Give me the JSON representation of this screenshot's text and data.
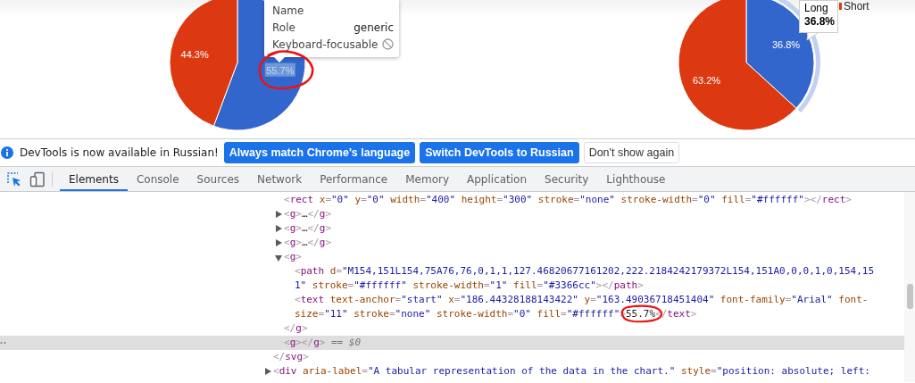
{
  "page": {
    "left_chart": {
      "chart_data": {
        "type": "pie",
        "values": [
          55.7,
          44.3
        ],
        "colors": [
          "#3366cc",
          "#dc3912"
        ]
      },
      "slices": [
        {
          "label": "55.7%",
          "label_selected": true
        },
        {
          "label": "44.3%",
          "label_selected": false
        }
      ]
    },
    "right_chart": {
      "chart_data": {
        "type": "pie",
        "values": [
          36.8,
          63.2
        ],
        "colors": [
          "#3366cc",
          "#dc3912"
        ]
      },
      "slices": [
        {
          "label": "36.8%",
          "hovered": true
        },
        {
          "label": "63.2%",
          "hovered": false
        }
      ],
      "tooltip": {
        "category": "Long",
        "value": "36.8%"
      },
      "legend": [
        {
          "label": "Short",
          "color": "#dc3912"
        }
      ]
    },
    "inspect_tooltip": {
      "rows": [
        {
          "label": "Name"
        },
        {
          "label": "Role",
          "value": "generic"
        },
        {
          "label": "Keyboard-focusable",
          "focusable": false
        }
      ]
    }
  },
  "info_bar": {
    "message": "DevTools is now available in Russian!",
    "buttons": [
      {
        "label": "Always match Chrome's language",
        "kind": "primary"
      },
      {
        "label": "Switch DevTools to Russian",
        "kind": "primary"
      },
      {
        "label": "Don't show again",
        "kind": "secondary"
      }
    ]
  },
  "tabs": [
    {
      "label": "Elements",
      "selected": true
    },
    {
      "label": "Console",
      "selected": false
    },
    {
      "label": "Sources",
      "selected": false
    },
    {
      "label": "Network",
      "selected": false
    },
    {
      "label": "Performance",
      "selected": false
    },
    {
      "label": "Memory",
      "selected": false
    },
    {
      "label": "Application",
      "selected": false
    },
    {
      "label": "Security",
      "selected": false
    },
    {
      "label": "Lighthouse",
      "selected": false
    }
  ],
  "dom_tree": [
    {
      "selected": false,
      "closing": [
        {
          "kind": "p",
          "text": "</"
        },
        {
          "kind": "tag",
          "text": "svg"
        },
        {
          "kind": "p",
          "text": ">"
        }
      ],
      "children": [
        {
          "selected": false,
          "lines": [
            [
              {
                "kind": "p",
                "text": "<"
              },
              {
                "kind": "tag",
                "text": "rect"
              },
              {
                "kind": "attr",
                "text": " x"
              },
              {
                "kind": "p",
                "text": "="
              },
              {
                "kind": "val",
                "text": "\"0\""
              },
              {
                "kind": "attr",
                "text": " y"
              },
              {
                "kind": "p",
                "text": "="
              },
              {
                "kind": "val",
                "text": "\"0\""
              },
              {
                "kind": "attr",
                "text": " width"
              },
              {
                "kind": "p",
                "text": "="
              },
              {
                "kind": "val",
                "text": "\"400\""
              },
              {
                "kind": "attr",
                "text": " height"
              },
              {
                "kind": "p",
                "text": "="
              },
              {
                "kind": "val",
                "text": "\"300\""
              },
              {
                "kind": "attr",
                "text": " stroke"
              },
              {
                "kind": "p",
                "text": "="
              },
              {
                "kind": "val",
                "text": "\"none\""
              },
              {
                "kind": "attr",
                "text": " stroke-width"
              },
              {
                "kind": "p",
                "text": "="
              },
              {
                "kind": "val",
                "text": "\"0\""
              },
              {
                "kind": "attr",
                "text": " fill"
              },
              {
                "kind": "p",
                "text": "="
              },
              {
                "kind": "val",
                "text": "\"#ffffff\""
              },
              {
                "kind": "p",
                "text": "></"
              },
              {
                "kind": "tag",
                "text": "rect"
              },
              {
                "kind": "p",
                "text": ">"
              }
            ]
          ]
        },
        {
          "selected": false,
          "expanded": false,
          "lines": [
            [
              {
                "kind": "p",
                "text": "<"
              },
              {
                "kind": "tag",
                "text": "g"
              },
              {
                "kind": "p",
                "text": ">"
              },
              {
                "kind": "text",
                "text": "…"
              },
              {
                "kind": "p",
                "text": "</"
              },
              {
                "kind": "tag",
                "text": "g"
              },
              {
                "kind": "p",
                "text": ">"
              }
            ]
          ]
        },
        {
          "selected": false,
          "expanded": false,
          "lines": [
            [
              {
                "kind": "p",
                "text": "<"
              },
              {
                "kind": "tag",
                "text": "g"
              },
              {
                "kind": "p",
                "text": ">"
              },
              {
                "kind": "text",
                "text": "…"
              },
              {
                "kind": "p",
                "text": "</"
              },
              {
                "kind": "tag",
                "text": "g"
              },
              {
                "kind": "p",
                "text": ">"
              }
            ]
          ]
        },
        {
          "selected": false,
          "expanded": false,
          "lines": [
            [
              {
                "kind": "p",
                "text": "<"
              },
              {
                "kind": "tag",
                "text": "g"
              },
              {
                "kind": "p",
                "text": ">"
              },
              {
                "kind": "text",
                "text": "…"
              },
              {
                "kind": "p",
                "text": "</"
              },
              {
                "kind": "tag",
                "text": "g"
              },
              {
                "kind": "p",
                "text": ">"
              }
            ]
          ]
        },
        {
          "selected": false,
          "expanded": true,
          "lines": [
            [
              {
                "kind": "p",
                "text": "<"
              },
              {
                "kind": "tag",
                "text": "g"
              },
              {
                "kind": "p",
                "text": ">"
              }
            ]
          ],
          "closing": [
            {
              "kind": "p",
              "text": "</"
            },
            {
              "kind": "tag",
              "text": "g"
            },
            {
              "kind": "p",
              "text": ">"
            }
          ],
          "children": [
            {
              "selected": false,
              "lines": [
                [
                  {
                    "kind": "p",
                    "text": "<"
                  },
                  {
                    "kind": "tag",
                    "text": "path"
                  },
                  {
                    "kind": "attr",
                    "text": " d"
                  },
                  {
                    "kind": "p",
                    "text": "="
                  },
                  {
                    "kind": "val",
                    "text": "\"M154,151L154,75A76,76,0,1,1,127.46820677161202,222.2184242179372L154,151A0,0,0,1,0,154,15"
                  }
                ],
                [
                  {
                    "kind": "val",
                    "text": "1\""
                  },
                  {
                    "kind": "attr",
                    "text": " stroke"
                  },
                  {
                    "kind": "p",
                    "text": "="
                  },
                  {
                    "kind": "val",
                    "text": "\"#ffffff\""
                  },
                  {
                    "kind": "attr",
                    "text": " stroke-width"
                  },
                  {
                    "kind": "p",
                    "text": "="
                  },
                  {
                    "kind": "val",
                    "text": "\"1\""
                  },
                  {
                    "kind": "attr",
                    "text": " fill"
                  },
                  {
                    "kind": "p",
                    "text": "="
                  },
                  {
                    "kind": "val",
                    "text": "\"#3366cc\""
                  },
                  {
                    "kind": "p",
                    "text": "></"
                  },
                  {
                    "kind": "tag",
                    "text": "path"
                  },
                  {
                    "kind": "p",
                    "text": ">"
                  }
                ]
              ]
            },
            {
              "selected": false,
              "lines": [
                [
                  {
                    "kind": "p",
                    "text": "<"
                  },
                  {
                    "kind": "tag",
                    "text": "text"
                  },
                  {
                    "kind": "attr",
                    "text": " text-anchor"
                  },
                  {
                    "kind": "p",
                    "text": "="
                  },
                  {
                    "kind": "val",
                    "text": "\"start\""
                  },
                  {
                    "kind": "attr",
                    "text": " x"
                  },
                  {
                    "kind": "p",
                    "text": "="
                  },
                  {
                    "kind": "val",
                    "text": "\"186.44328188143422\""
                  },
                  {
                    "kind": "attr",
                    "text": " y"
                  },
                  {
                    "kind": "p",
                    "text": "="
                  },
                  {
                    "kind": "val",
                    "text": "\"163.49036718451404\""
                  },
                  {
                    "kind": "attr",
                    "text": " font-family"
                  },
                  {
                    "kind": "p",
                    "text": "="
                  },
                  {
                    "kind": "val",
                    "text": "\"Arial\""
                  },
                  {
                    "kind": "attr",
                    "text": " font-"
                  }
                ],
                [
                  {
                    "kind": "attr",
                    "text": "size"
                  },
                  {
                    "kind": "p",
                    "text": "="
                  },
                  {
                    "kind": "val",
                    "text": "\"11\""
                  },
                  {
                    "kind": "attr",
                    "text": " stroke"
                  },
                  {
                    "kind": "p",
                    "text": "="
                  },
                  {
                    "kind": "val",
                    "text": "\"none\""
                  },
                  {
                    "kind": "attr",
                    "text": " stroke-width"
                  },
                  {
                    "kind": "p",
                    "text": "="
                  },
                  {
                    "kind": "val",
                    "text": "\"0\""
                  },
                  {
                    "kind": "attr",
                    "text": " fill"
                  },
                  {
                    "kind": "p",
                    "text": "="
                  },
                  {
                    "kind": "val",
                    "text": "\"#ffffff\""
                  },
                  {
                    "kind": "p",
                    "text": ">"
                  },
                  {
                    "kind": "text",
                    "text": "55.7%"
                  },
                  {
                    "kind": "p",
                    "text": "</"
                  },
                  {
                    "kind": "tag",
                    "text": "text"
                  },
                  {
                    "kind": "p",
                    "text": ">"
                  }
                ]
              ]
            }
          ]
        },
        {
          "selected": true,
          "lines": [
            [
              {
                "kind": "p",
                "text": "<"
              },
              {
                "kind": "tag",
                "text": "g"
              },
              {
                "kind": "p",
                "text": "></"
              },
              {
                "kind": "tag",
                "text": "g"
              },
              {
                "kind": "p",
                "text": ">"
              },
              {
                "kind": "ref",
                "text": " == $0"
              }
            ]
          ]
        }
      ]
    },
    {
      "selected": false,
      "expanded": false,
      "lines": [
        [
          {
            "kind": "p",
            "text": "<"
          },
          {
            "kind": "tag",
            "text": "div"
          },
          {
            "kind": "attr",
            "text": " aria-label"
          },
          {
            "kind": "p",
            "text": "="
          },
          {
            "kind": "val",
            "text": "\"A tabular representation of the data in the chart.\""
          },
          {
            "kind": "attr",
            "text": " style"
          },
          {
            "kind": "p",
            "text": "="
          },
          {
            "kind": "val",
            "text": "\"position: absolute; left:"
          }
        ]
      ]
    }
  ]
}
